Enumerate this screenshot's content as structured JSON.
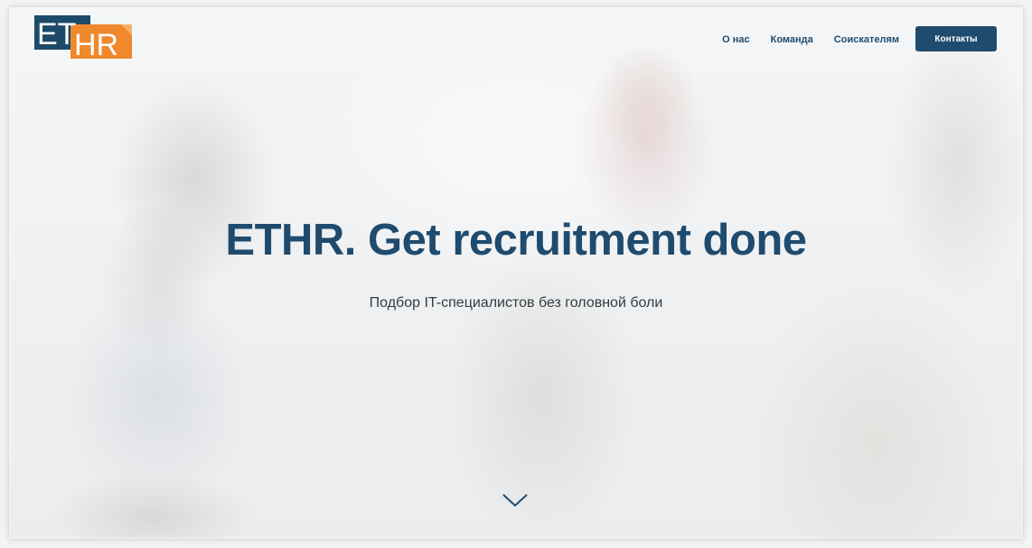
{
  "brand": {
    "logo_text_left": "ET",
    "logo_text_right": "HR",
    "colors": {
      "primary": "#1f4b6e",
      "logo_dark": "#1e4a6a",
      "logo_orange": "#f0882c"
    }
  },
  "nav": {
    "items": [
      {
        "label": "О нас"
      },
      {
        "label": "Команда"
      },
      {
        "label": "Соискателям"
      }
    ],
    "cta_label": "Контакты"
  },
  "hero": {
    "title": "ETHR. Get recruitment done",
    "subtitle": "Подбор IT-специалистов без головной боли",
    "scroll_icon": "chevron-down-icon"
  }
}
